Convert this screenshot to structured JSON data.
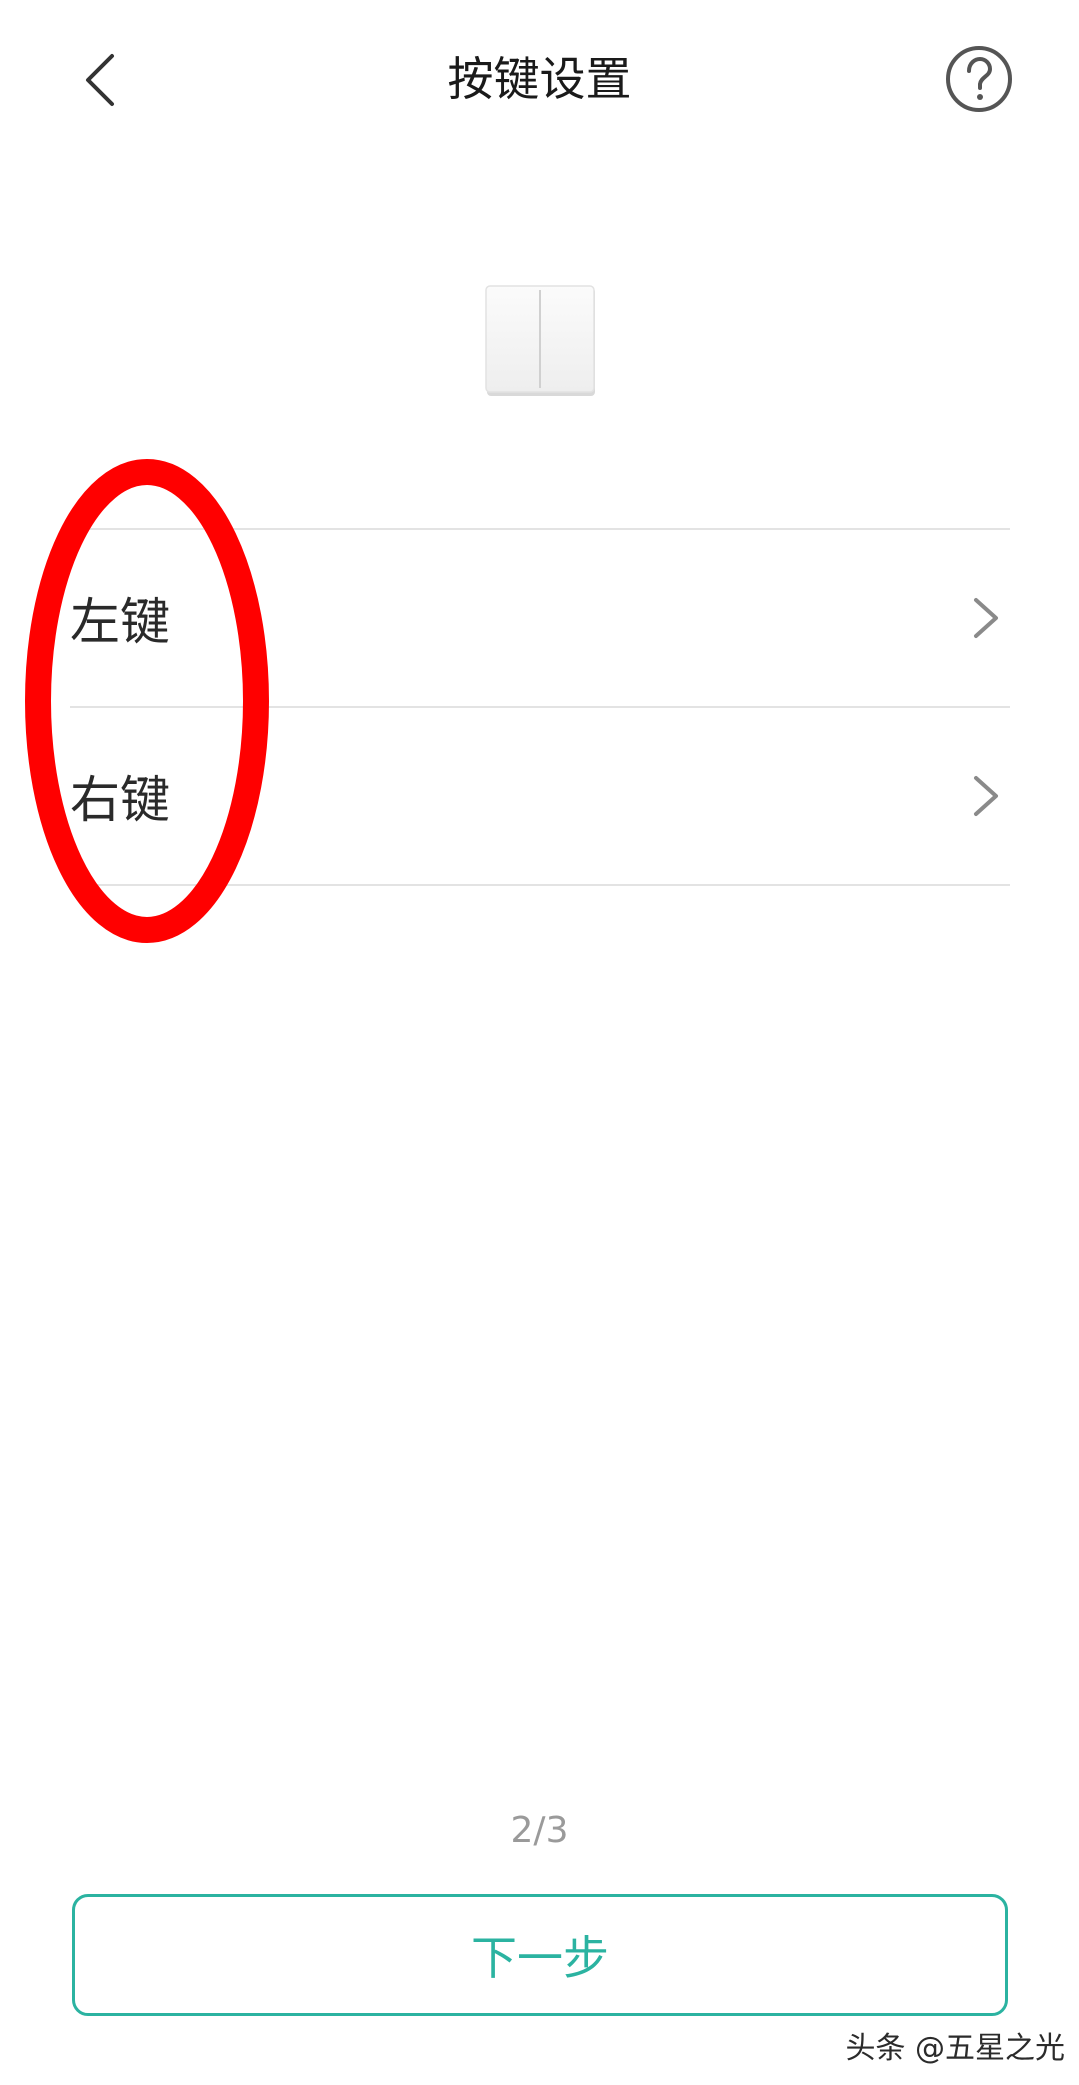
{
  "header": {
    "title": "按键设置",
    "back_icon": "chevron-left-icon",
    "help_icon": "question-circle-icon"
  },
  "device": {
    "image": "double-rocker-switch"
  },
  "keys": [
    {
      "label": "左键",
      "icon": "chevron-right-icon"
    },
    {
      "label": "右键",
      "icon": "chevron-right-icon"
    }
  ],
  "annotation": {
    "shape": "ellipse",
    "color": "#ff0000"
  },
  "pager": {
    "text": "2/3"
  },
  "footer": {
    "next_label": "下一步",
    "accent_color": "#2bb3a1"
  },
  "watermark": {
    "text": "头条 @五星之光"
  }
}
